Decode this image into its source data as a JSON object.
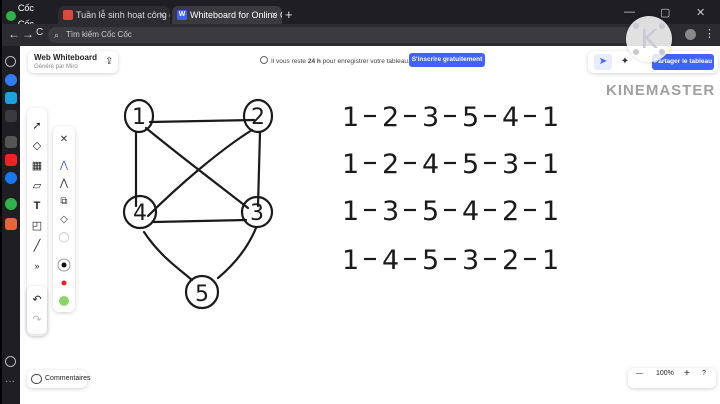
{
  "browser": {
    "brand": "Cốc Cốc",
    "tabs": [
      {
        "label": "Tuần lễ sinh hoạt công dân ví",
        "favicon": "red-flag-icon"
      },
      {
        "label": "Whiteboard for Online Collab",
        "favicon": "whiteboard-w-icon"
      }
    ],
    "new_tab": "+",
    "window_controls": {
      "minimize": "—",
      "maximize": "▢",
      "close": "✕"
    },
    "address_placeholder": "Tìm kiếm Cốc Cốc",
    "nav": {
      "back": "←",
      "forward": "→",
      "reload": "C"
    }
  },
  "app": {
    "title": "Web Whiteboard",
    "subtitle": "Généré par Miro",
    "notice_prefix": "Il vous reste ",
    "notice_bold": "24 h",
    "notice_suffix": " pour enregistrer votre tableau.",
    "signup_button": "S'inscrire gratuitement",
    "share_button": "Partager le tableau",
    "comments": "Commentaires",
    "zoom": "100%",
    "zoom_minus": "—",
    "zoom_plus": "+",
    "zoom_help": "?"
  },
  "watermark": "KINEMASTER",
  "drawing": {
    "nodes": [
      "1",
      "2",
      "3",
      "4",
      "5"
    ],
    "cycles": [
      [
        "1",
        "2",
        "3",
        "5",
        "4",
        "1"
      ],
      [
        "1",
        "2",
        "4",
        "5",
        "3",
        "1"
      ],
      [
        "1",
        "3",
        "5",
        "4",
        "2",
        "1"
      ],
      [
        "1",
        "4",
        "5",
        "3",
        "2",
        "1"
      ]
    ]
  },
  "colors": {
    "accent": "#4262ff",
    "browser_dark": "#1f1f23"
  }
}
